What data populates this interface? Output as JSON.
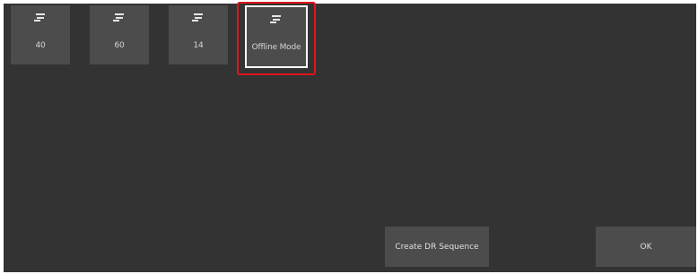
{
  "tiles": [
    {
      "label": "40",
      "icon": "detector-icon"
    },
    {
      "label": "60",
      "icon": "detector-icon"
    },
    {
      "label": "14",
      "icon": "detector-icon"
    },
    {
      "label": "Offline Mode",
      "icon": "detector-icon"
    }
  ],
  "buttons": {
    "create_dr_sequence": "Create DR Sequence",
    "ok": "OK"
  },
  "colors": {
    "background": "#333333",
    "tile": "#4c4c4c",
    "text": "#d6d6d6",
    "highlight": "#e0141b"
  }
}
